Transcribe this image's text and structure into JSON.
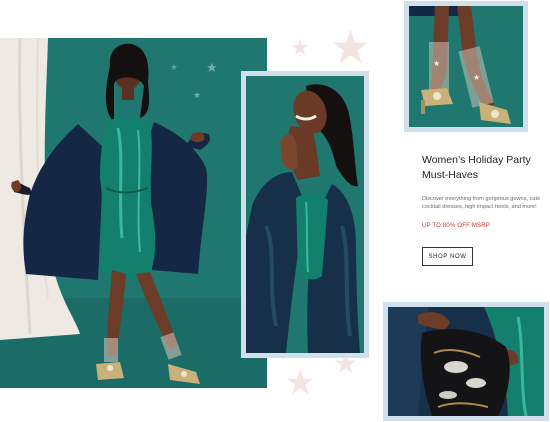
{
  "promo": {
    "title_line1": "Women’s Holiday Party",
    "title_line2": "Must-Haves",
    "description": "Discover everything from gorgeous gowns, cute cocktail dresses, high impact heels, and more!",
    "offer": "UP TO 80% OFF MSRP",
    "button_label": "SHOP NOW"
  },
  "colors": {
    "teal_background": "#1f7770",
    "frame_blue": "#cfe0ec",
    "accent_red": "#c0392b",
    "star_pink": "#f3e4e1",
    "dress_green": "#12806d",
    "velvet_navy": "#162848"
  },
  "icons": [
    "star-icon"
  ]
}
